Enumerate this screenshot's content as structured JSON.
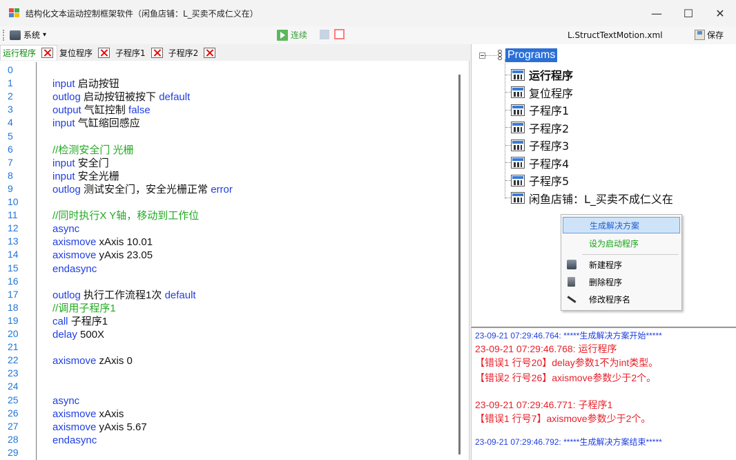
{
  "window": {
    "title": "结构化文本运动控制框架软件（闲鱼店铺：L_买卖不成仁义在）",
    "minimize_glyph": "—",
    "maximize_glyph": "☐",
    "close_glyph": "✕"
  },
  "toolbar": {
    "system_label": "系统",
    "system_arrow": "▾",
    "run_label": "连续",
    "file_name": "L.StructTextMotion.xml",
    "save_label": "保存"
  },
  "tabs": [
    {
      "label": "运行程序"
    },
    {
      "label": "复位程序"
    },
    {
      "label": "子程序1"
    },
    {
      "label": "子程序2"
    }
  ],
  "editor": {
    "line_numbers": [
      "0",
      "1",
      "2",
      "3",
      "4",
      "5",
      "6",
      "7",
      "8",
      "9",
      "10",
      "11",
      "12",
      "13",
      "14",
      "15",
      "16",
      "17",
      "18",
      "19",
      "20",
      "21",
      "22",
      "23",
      "24",
      "25",
      "26",
      "27",
      "28",
      "29"
    ],
    "lines": [
      {
        "n": 1,
        "parts": [
          {
            "t": "input ",
            "c": "kw"
          },
          {
            "t": "启动按钮",
            "c": ""
          }
        ]
      },
      {
        "n": 2,
        "parts": [
          {
            "t": "outlog ",
            "c": "kw"
          },
          {
            "t": "启动按钮被按下 ",
            "c": ""
          },
          {
            "t": "default",
            "c": "kw"
          }
        ]
      },
      {
        "n": 3,
        "parts": [
          {
            "t": "output ",
            "c": "kw"
          },
          {
            "t": "气缸控制 ",
            "c": ""
          },
          {
            "t": "false",
            "c": "kw"
          }
        ]
      },
      {
        "n": 4,
        "parts": [
          {
            "t": "input ",
            "c": "kw"
          },
          {
            "t": "气缸缩回感应",
            "c": ""
          }
        ]
      },
      {
        "n": 6,
        "parts": [
          {
            "t": "//检测安全门 光栅",
            "c": "cm"
          }
        ]
      },
      {
        "n": 7,
        "parts": [
          {
            "t": "input ",
            "c": "kw"
          },
          {
            "t": "安全门",
            "c": ""
          }
        ]
      },
      {
        "n": 8,
        "parts": [
          {
            "t": "input ",
            "c": "kw"
          },
          {
            "t": "安全光栅",
            "c": ""
          }
        ]
      },
      {
        "n": 9,
        "parts": [
          {
            "t": "outlog ",
            "c": "kw"
          },
          {
            "t": "测试安全门，安全光栅正常 ",
            "c": ""
          },
          {
            "t": "error",
            "c": "kw"
          }
        ]
      },
      {
        "n": 11,
        "parts": [
          {
            "t": "//同时执行X Y轴，移动到工作位",
            "c": "cm"
          }
        ]
      },
      {
        "n": 12,
        "parts": [
          {
            "t": "async",
            "c": "kw"
          }
        ]
      },
      {
        "n": 13,
        "parts": [
          {
            "t": "axismove ",
            "c": "kw"
          },
          {
            "t": "xAxis 10.01",
            "c": ""
          }
        ]
      },
      {
        "n": 14,
        "parts": [
          {
            "t": "axismove ",
            "c": "kw"
          },
          {
            "t": "yAxis 23.05",
            "c": ""
          }
        ]
      },
      {
        "n": 15,
        "parts": [
          {
            "t": "endasync",
            "c": "kw"
          }
        ]
      },
      {
        "n": 17,
        "parts": [
          {
            "t": "outlog ",
            "c": "kw"
          },
          {
            "t": "执行工作流程1次 ",
            "c": ""
          },
          {
            "t": "default",
            "c": "kw"
          }
        ]
      },
      {
        "n": 18,
        "parts": [
          {
            "t": "//调用子程序1",
            "c": "cm"
          }
        ]
      },
      {
        "n": 19,
        "parts": [
          {
            "t": "call ",
            "c": "kw"
          },
          {
            "t": "子程序1",
            "c": ""
          }
        ]
      },
      {
        "n": 20,
        "parts": [
          {
            "t": "delay ",
            "c": "kw"
          },
          {
            "t": "500X",
            "c": ""
          }
        ]
      },
      {
        "n": 22,
        "parts": [
          {
            "t": "axismove ",
            "c": "kw"
          },
          {
            "t": "zAxis 0",
            "c": ""
          }
        ]
      },
      {
        "n": 25,
        "parts": [
          {
            "t": "async",
            "c": "kw"
          }
        ]
      },
      {
        "n": 26,
        "parts": [
          {
            "t": "axismove ",
            "c": "kw"
          },
          {
            "t": "xAxis",
            "c": ""
          }
        ]
      },
      {
        "n": 27,
        "parts": [
          {
            "t": "axismove ",
            "c": "kw"
          },
          {
            "t": "yAxis 5.67",
            "c": ""
          }
        ]
      },
      {
        "n": 28,
        "parts": [
          {
            "t": "endasync",
            "c": "kw"
          }
        ]
      }
    ]
  },
  "tree": {
    "root": "Programs",
    "items": [
      {
        "label": "运行程序",
        "bold": true
      },
      {
        "label": "复位程序",
        "bold": false
      },
      {
        "label": "子程序1",
        "bold": false
      },
      {
        "label": "子程序2",
        "bold": false
      },
      {
        "label": "子程序3",
        "bold": false
      },
      {
        "label": "子程序4",
        "bold": false
      },
      {
        "label": "子程序5",
        "bold": false
      },
      {
        "label": "闲鱼店铺：L_买卖不成仁义在",
        "bold": false
      }
    ]
  },
  "context_menu": {
    "generate": "生成解决方案",
    "set_startup": "设为启动程序",
    "new_program": "新建程序",
    "delete_program": "删除程序",
    "rename_program": "修改程序名"
  },
  "output": {
    "lines": [
      {
        "text": "23-09-21 07:29:46.764: *****生成解决方案开始*****",
        "style": "blue"
      },
      {
        "text": "23-09-21 07:29:46.768: 运行程序",
        "style": "red"
      },
      {
        "text": "【错误1 行号20】delay参数1不为int类型。",
        "style": "red"
      },
      {
        "text": "【错误2 行号26】axismove参数少于2个。",
        "style": "red"
      },
      {
        "text": "",
        "style": "red"
      },
      {
        "text": "23-09-21 07:29:46.771: 子程序1",
        "style": "red"
      },
      {
        "text": "【错误1 行号7】axismove参数少于2个。",
        "style": "red"
      },
      {
        "text": "",
        "style": "red"
      },
      {
        "text": "23-09-21 07:29:46.792: *****生成解决方案结束*****",
        "style": "blue"
      }
    ]
  },
  "colors": {
    "keyword": "#1f3fe0",
    "comment": "#22aa22",
    "line_number": "#1e74d6",
    "error": "#e8202a",
    "selection": "#2b6fd6"
  }
}
